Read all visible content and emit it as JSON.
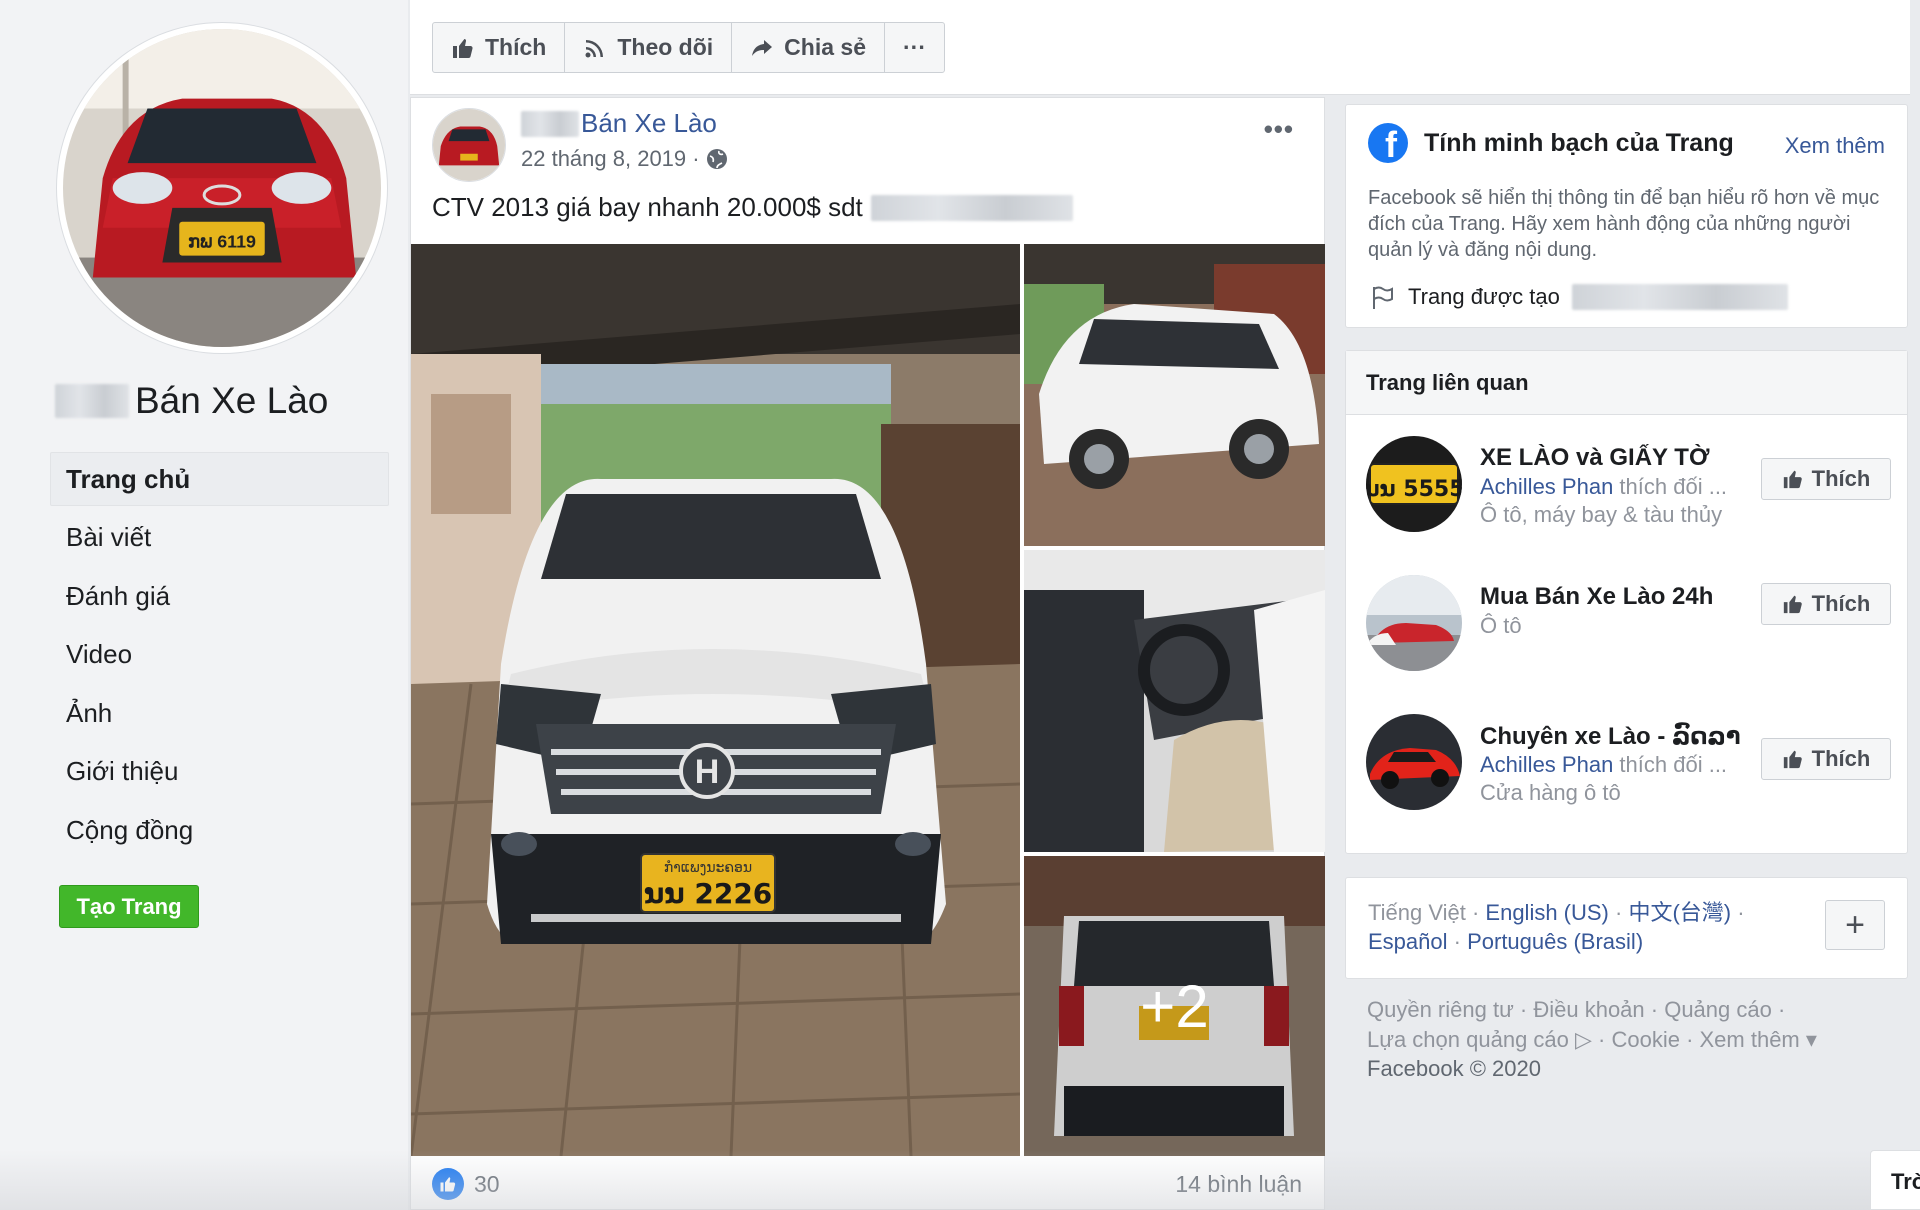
{
  "page": {
    "name": "Bán Xe Lào"
  },
  "nav": {
    "items": [
      "Trang chủ",
      "Bài viết",
      "Đánh giá",
      "Video",
      "Ảnh",
      "Giới thiệu",
      "Cộng đồng"
    ],
    "active": "Trang chủ",
    "create_page": "Tạo Trang"
  },
  "action_bar": {
    "like": "Thích",
    "follow": "Theo dõi",
    "share": "Chia sẻ",
    "more": "···"
  },
  "post": {
    "author": "Bán Xe Lào",
    "date": "22 tháng 8, 2019 ·",
    "text": "CTV 2013 giá bay nhanh 20.000$ sdt",
    "more_photos": "+2",
    "likes": "30",
    "comments": "14 bình luận",
    "plate_main": "ນນ 2226",
    "plate_header": "ກໍາແພງນະຄອນ"
  },
  "transparency": {
    "title": "Tính minh bạch của Trang",
    "see_more": "Xem thêm",
    "description": "Facebook sẽ hiển thị thông tin để bạn hiểu rõ hơn về mục đích của Trang. Hãy xem hành động của những người quản lý và đăng nội dung.",
    "created": "Trang được tạo"
  },
  "related": {
    "title": "Trang liên quan",
    "like_label": "Thích",
    "items": [
      {
        "name": "XE LÀO và GIẤY TỜ",
        "liker": "Achilles Phan",
        "liker_suffix": " thích đối ...",
        "category": "Ô tô, máy bay & tàu thủy",
        "plate": "ນນ 5555"
      },
      {
        "name": "Mua Bán Xe Lào 24h",
        "liker": "",
        "liker_suffix": "",
        "category": "Ô tô"
      },
      {
        "name": "Chuyên xe Lào - ລົດລາ...",
        "liker": "Achilles Phan",
        "liker_suffix": " thích đối ...",
        "category": "Cửa hàng ô tô"
      }
    ]
  },
  "languages": {
    "current": "Tiếng Việt",
    "sep": " · ",
    "others": [
      "English (US)",
      "中文(台灣)",
      "Español",
      "Português (Brasil)"
    ],
    "add": "+"
  },
  "footer": {
    "line1": "Quyền riêng tư · Điều khoản · Quảng cáo ·",
    "line2": "Lựa chọn quảng cáo ▷ · Cookie · Xem thêm ▾",
    "copyright": "Facebook © 2020"
  },
  "corner": {
    "label": "Trò"
  },
  "colors": {
    "link": "#385898",
    "facebook_blue": "#1877f2",
    "create_green": "#42b72a"
  }
}
